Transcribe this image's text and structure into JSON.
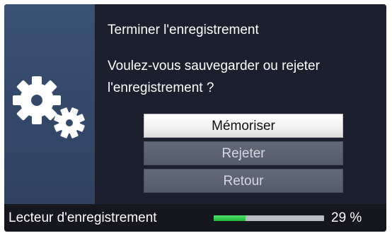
{
  "dialog": {
    "title": "Terminer l'enregistrement",
    "message": "Voulez-vous sauvegarder ou rejeter l'enregistrement ?",
    "icon": "gears-icon",
    "buttons": [
      {
        "label": "Mémoriser",
        "selected": true
      },
      {
        "label": "Rejeter",
        "selected": false
      },
      {
        "label": "Retour",
        "selected": false
      }
    ]
  },
  "status": {
    "label": "Lecteur d'enregistrement",
    "progress_value": 29,
    "progress_text": "29 %"
  },
  "colors": {
    "dialog_bg": "#1b1f2e",
    "side_panel": "#34496a",
    "progress_fill": "#21b63a",
    "progress_track": "#b9bcc2"
  }
}
